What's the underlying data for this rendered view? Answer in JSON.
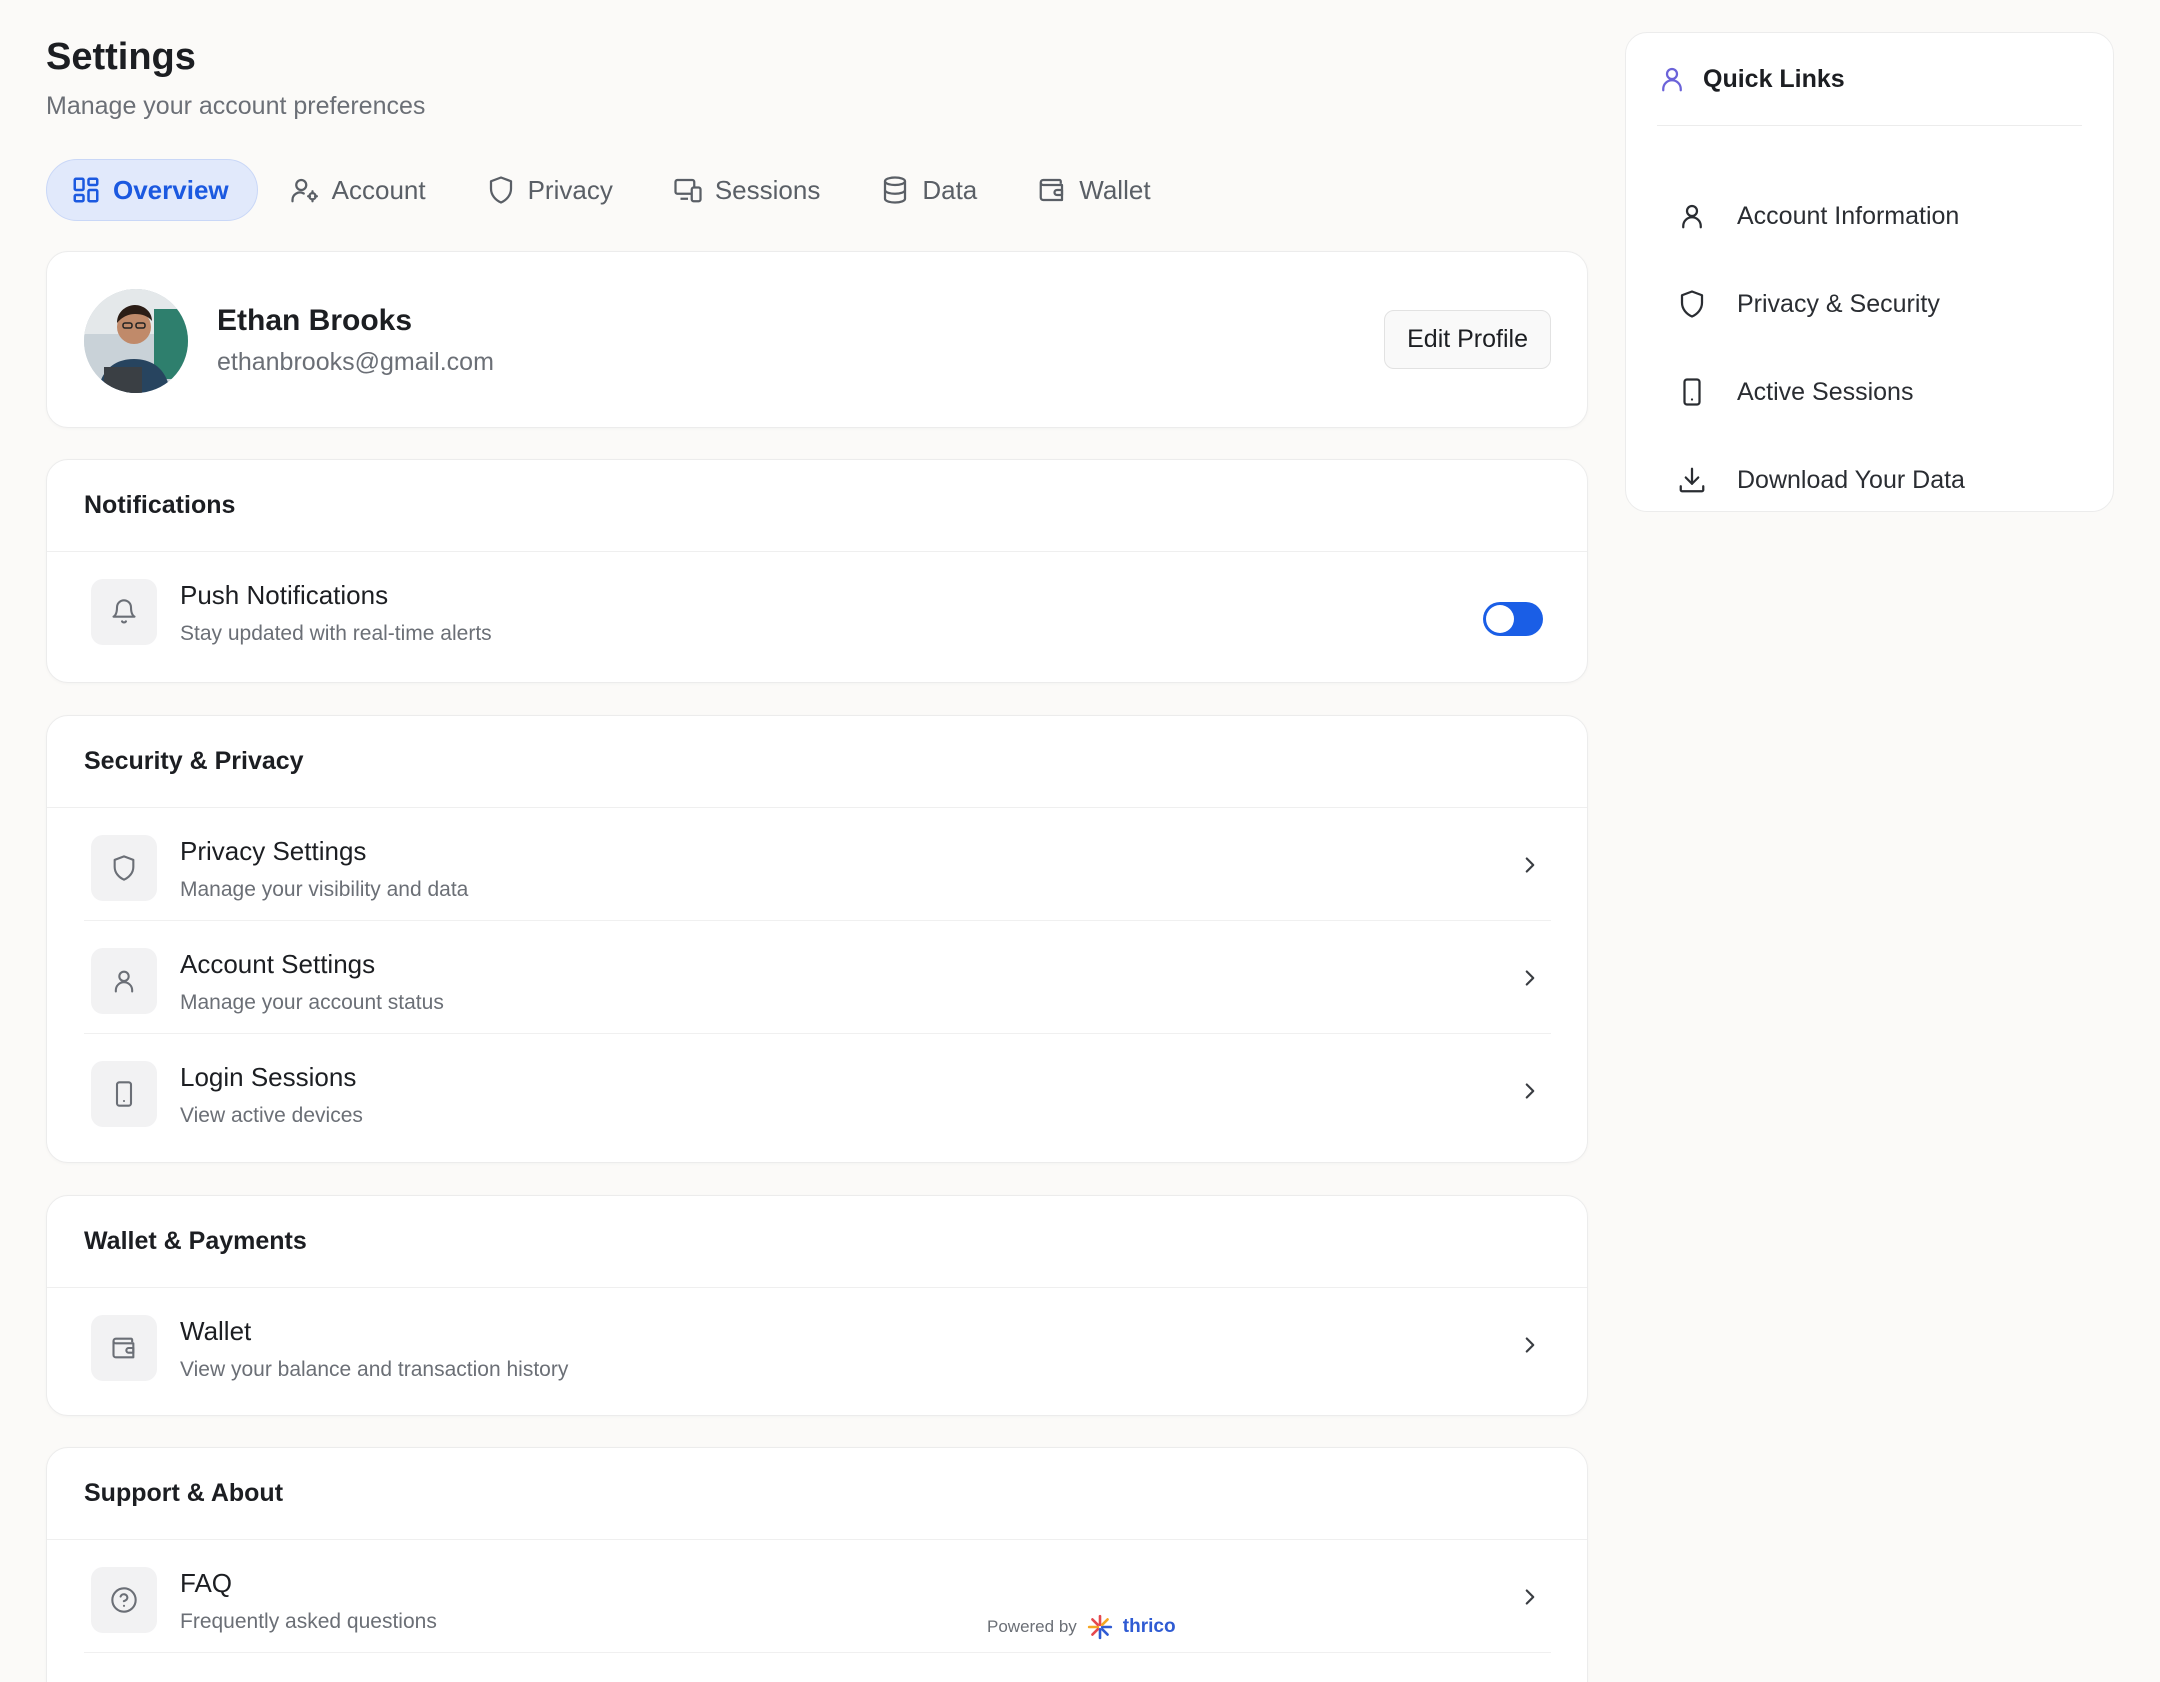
{
  "header": {
    "title": "Settings",
    "subtitle": "Manage your account preferences"
  },
  "tabs": [
    {
      "label": "Overview",
      "icon": "grid-icon",
      "active": true
    },
    {
      "label": "Account",
      "icon": "user-gear-icon"
    },
    {
      "label": "Privacy",
      "icon": "shield-icon"
    },
    {
      "label": "Sessions",
      "icon": "devices-icon"
    },
    {
      "label": "Data",
      "icon": "database-icon"
    },
    {
      "label": "Wallet",
      "icon": "wallet-icon"
    }
  ],
  "profile": {
    "name": "Ethan Brooks",
    "email": "ethanbrooks@gmail.com",
    "edit_label": "Edit Profile"
  },
  "notifications": {
    "title": "Notifications",
    "items": [
      {
        "title": "Push Notifications",
        "desc": "Stay updated with real-time alerts",
        "enabled": true
      }
    ]
  },
  "security": {
    "title": "Security & Privacy",
    "items": [
      {
        "title": "Privacy Settings",
        "desc": "Manage your visibility and data"
      },
      {
        "title": "Account Settings",
        "desc": "Manage your account status"
      },
      {
        "title": "Login Sessions",
        "desc": "View active devices"
      }
    ]
  },
  "wallet": {
    "title": "Wallet & Payments",
    "items": [
      {
        "title": "Wallet",
        "desc": "View your balance and transaction history"
      }
    ]
  },
  "support": {
    "title": "Support & About",
    "items": [
      {
        "title": "FAQ",
        "desc": "Frequently asked questions"
      }
    ]
  },
  "footer": {
    "powered_label": "Powered by",
    "brand": "thrico"
  },
  "quick_links": {
    "title": "Quick Links",
    "items": [
      {
        "label": "Account Information",
        "icon": "user-icon"
      },
      {
        "label": "Privacy & Security",
        "icon": "shield-icon"
      },
      {
        "label": "Active Sessions",
        "icon": "phone-icon"
      },
      {
        "label": "Download Your Data",
        "icon": "download-icon"
      }
    ]
  },
  "colors": {
    "accent": "#1b59e0",
    "toggle_on": "#1a5ee6",
    "background": "#fbfaf8",
    "quick_links_icon": "#6b63d9"
  }
}
